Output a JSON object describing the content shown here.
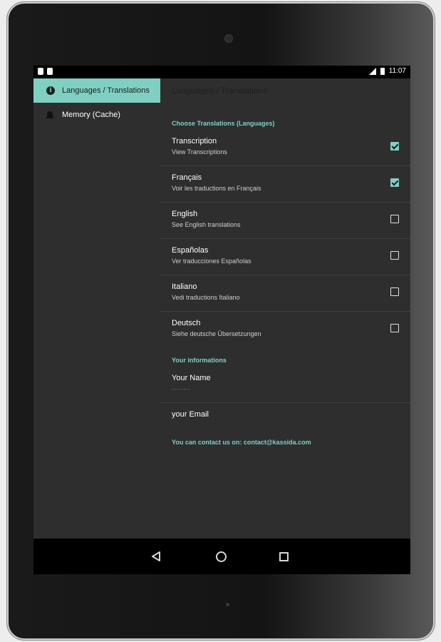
{
  "status_bar": {
    "time": "11:07"
  },
  "sidebar": {
    "items": [
      {
        "label": "Languages / Translations",
        "icon": "info-icon",
        "active": true
      },
      {
        "label": "Memory (Cache)",
        "icon": "bell-icon",
        "active": false
      }
    ]
  },
  "content": {
    "title": "Languages / Translations",
    "translations_header": "Choose Translations (Languages)",
    "translations": [
      {
        "title": "Transcription",
        "subtitle": "View Transcriptions",
        "checked": true
      },
      {
        "title": "Français",
        "subtitle": "Voir les traductions en Français",
        "checked": true
      },
      {
        "title": "English",
        "subtitle": "See English translations",
        "checked": false
      },
      {
        "title": "Españolas",
        "subtitle": "Ver traducciones Españolas",
        "checked": false
      },
      {
        "title": "Italiano",
        "subtitle": "Vedi traductions Italiano",
        "checked": false
      },
      {
        "title": "Deutsch",
        "subtitle": "Siehe deutsche Übersetzungen",
        "checked": false
      }
    ],
    "info_header": "Your informations",
    "name_label": "Your Name",
    "name_value": "--------",
    "email_label": "your Email",
    "contact": "You can contact us on: contact@kassida.com"
  },
  "colors": {
    "accent": "#7fd0c3",
    "background": "#2e2e2e",
    "divider": "#3e3e3e"
  }
}
